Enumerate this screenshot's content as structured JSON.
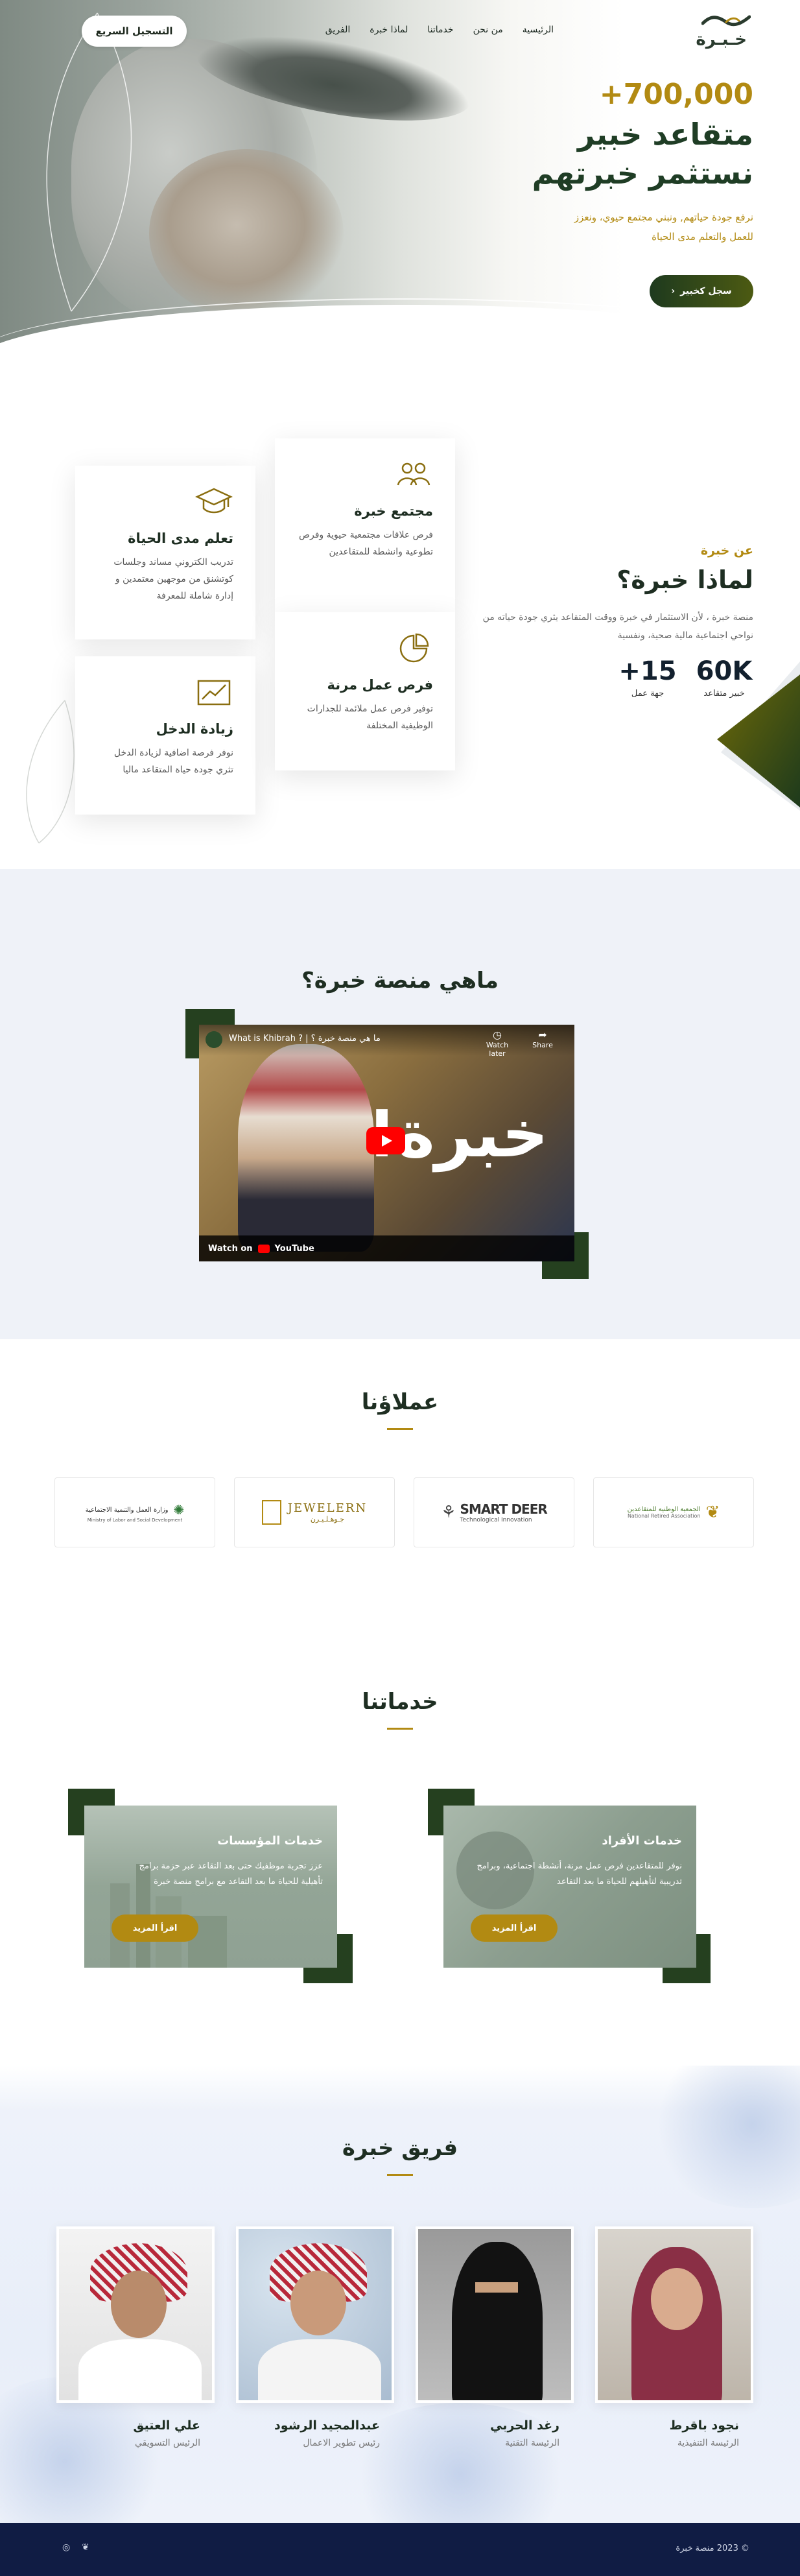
{
  "header": {
    "register_button": "التسجيل السريع",
    "nav": [
      "الرئيسية",
      "من نحن",
      "خدماتنا",
      "لماذا خبرة",
      "الفريق"
    ],
    "logo_text": "خـبـرة"
  },
  "hero": {
    "count": "+700,000",
    "title_line1": "متقاعد خبير",
    "title_line2": "نستثمر خبرتهم",
    "subtitle": "نرفع جودة حياتهم, ونبني مجتمع حيوي، ونعزز للعمل والتعلم مدى الحياة",
    "cta": "سجل كخبير"
  },
  "why": {
    "eyebrow": "عن خبرة",
    "title": "لماذا خبرة؟",
    "text": "منصة خبرة ، لأن الاستثمار في خبرة ووقت المتقاعد يثري جودة حياته من نواحي اجتماعية مالية صحية، ونفسية",
    "stats": [
      {
        "number": "60K",
        "label": "خبير متقاعد"
      },
      {
        "number": "+15",
        "label": "جهة عمل"
      }
    ],
    "cards": [
      {
        "icon": "community-icon",
        "title": "مجتمع خبرة",
        "text": "فرص علاقات مجتمعية حيوية وفرص تطوعية وانشطة للمتقاعدين"
      },
      {
        "icon": "graduation-cap-icon",
        "title": "تعلم مدى الحياة",
        "text": "تدريب الكتروني مساند وجلسات كوتشنق من موجهين معتمدين و إدارة شاملة للمعرفة"
      },
      {
        "icon": "pie-chart-icon",
        "title": "فرص عمل مرنة",
        "text": "توفير فرص عمل ملائمة للجدارات الوظيفية المختلفة"
      },
      {
        "icon": "income-chart-icon",
        "title": "زيادة الدخل",
        "text": "نوفر فرصة اضافية لزيادة الدخل تثري جودة حياة المتقاعد ماليا"
      }
    ]
  },
  "whatis": {
    "title": "ماهي منصة خبرة؟",
    "video_title": "What is Khibrah ? | ما هي منصة خبرة ؟",
    "watch_later": "Watch later",
    "share": "Share",
    "video_overlay": "خبرة!",
    "watch_on": "Watch on",
    "youtube": "YouTube"
  },
  "clients": {
    "title": "عملاؤنا",
    "logos": [
      {
        "name": "وزارة العمل والتنمية الاجتماعية",
        "sub": "Ministry of Labor and Social Development"
      },
      {
        "name": "JEWELERN",
        "sub": "جـوهـلـيـرن"
      },
      {
        "name": "SMART DEER",
        "sub": "Technological Innovation"
      },
      {
        "name": "الجمعية الوطنية للمتقاعدين",
        "sub": "National Retired Association"
      }
    ]
  },
  "services": {
    "title": "خدماتنا",
    "items": [
      {
        "title": "خدمات الأفراد",
        "text": "نوفر للمتقاعدين فرص عمل مرنة، أنشطة اجتماعية، وبرامج تدريبية لتأهيلهم للحياة ما بعد التقاعد",
        "button": "اقرأ المزيد"
      },
      {
        "title": "خدمات المؤسسات",
        "text": "عزز تجربة موظفيك حتى بعد التقاعد عبر حزمة برامج تأهيلية للحياة ما بعد التقاعد مع برامج منصة خبرة",
        "button": "اقرأ المزيد"
      }
    ]
  },
  "team": {
    "title": "فريق خبرة",
    "members": [
      {
        "name": "نجود باقرط",
        "role": "الرئيسة التنفيذية"
      },
      {
        "name": "رغد الحربي",
        "role": "الرئيسة التقنية"
      },
      {
        "name": "عبدالمجيد الرشود",
        "role": "رئيس تطوير الاعمال"
      },
      {
        "name": "علي العتيق",
        "role": "الرئيس التسويقي"
      }
    ]
  },
  "footer": {
    "copyright": "© 2023 منصة خبرة",
    "social": [
      "twitter-icon",
      "instagram-icon"
    ]
  },
  "colors": {
    "gold": "#b28a12",
    "dark_green": "#1f3d25",
    "footer_navy": "#101c44",
    "section_bg": "#eff2f8"
  }
}
